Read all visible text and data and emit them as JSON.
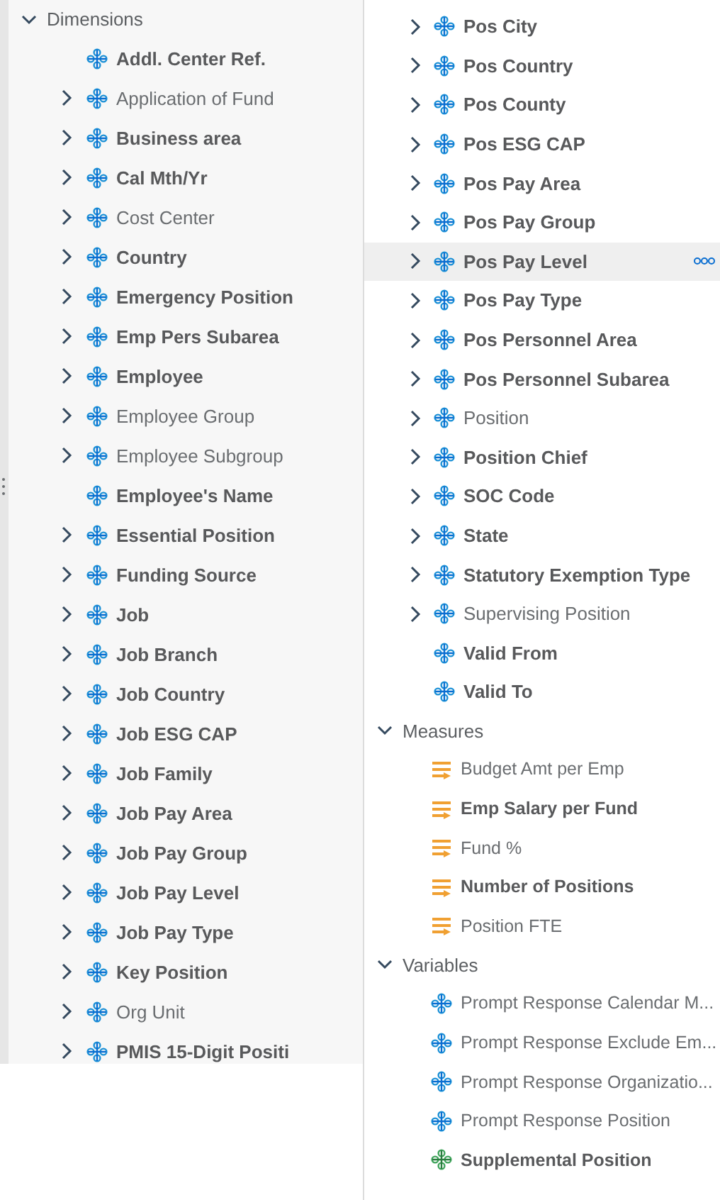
{
  "left_panel": {
    "sections": [
      {
        "title": "Dimensions",
        "expanded": true,
        "items": [
          {
            "label": "Addl. Center Ref.",
            "kind": "dimension",
            "expandable": false,
            "bold": true
          },
          {
            "label": "Application of Fund",
            "kind": "dimension",
            "expandable": true,
            "bold": false
          },
          {
            "label": "Business area",
            "kind": "dimension",
            "expandable": true,
            "bold": true
          },
          {
            "label": "Cal Mth/Yr",
            "kind": "dimension",
            "expandable": true,
            "bold": true
          },
          {
            "label": "Cost Center",
            "kind": "dimension",
            "expandable": true,
            "bold": false
          },
          {
            "label": "Country",
            "kind": "dimension",
            "expandable": true,
            "bold": true
          },
          {
            "label": "Emergency Position",
            "kind": "dimension",
            "expandable": true,
            "bold": true
          },
          {
            "label": "Emp Pers Subarea",
            "kind": "dimension",
            "expandable": true,
            "bold": true
          },
          {
            "label": "Employee",
            "kind": "dimension",
            "expandable": true,
            "bold": true
          },
          {
            "label": "Employee Group",
            "kind": "dimension",
            "expandable": true,
            "bold": false
          },
          {
            "label": "Employee Subgroup",
            "kind": "dimension",
            "expandable": true,
            "bold": false
          },
          {
            "label": "Employee's Name",
            "kind": "dimension",
            "expandable": false,
            "bold": true
          },
          {
            "label": "Essential Position",
            "kind": "dimension",
            "expandable": true,
            "bold": true
          },
          {
            "label": "Funding Source",
            "kind": "dimension",
            "expandable": true,
            "bold": true
          },
          {
            "label": "Job",
            "kind": "dimension",
            "expandable": true,
            "bold": true
          },
          {
            "label": "Job Branch",
            "kind": "dimension",
            "expandable": true,
            "bold": true
          },
          {
            "label": "Job Country",
            "kind": "dimension",
            "expandable": true,
            "bold": true
          },
          {
            "label": "Job ESG CAP",
            "kind": "dimension",
            "expandable": true,
            "bold": true
          },
          {
            "label": "Job Family",
            "kind": "dimension",
            "expandable": true,
            "bold": true
          },
          {
            "label": "Job Pay Area",
            "kind": "dimension",
            "expandable": true,
            "bold": true
          },
          {
            "label": "Job Pay Group",
            "kind": "dimension",
            "expandable": true,
            "bold": true
          },
          {
            "label": "Job Pay Level",
            "kind": "dimension",
            "expandable": true,
            "bold": true
          },
          {
            "label": "Job Pay Type",
            "kind": "dimension",
            "expandable": true,
            "bold": true
          },
          {
            "label": "Key Position",
            "kind": "dimension",
            "expandable": true,
            "bold": true
          },
          {
            "label": "Org Unit",
            "kind": "dimension",
            "expandable": true,
            "bold": false
          },
          {
            "label": "PMIS 15-Digit Positi",
            "kind": "dimension",
            "expandable": true,
            "bold": true
          }
        ]
      }
    ]
  },
  "right_panel": {
    "items": [
      {
        "label": "Pos City",
        "kind": "dimension",
        "expandable": true,
        "bold": true,
        "hovered": false
      },
      {
        "label": "Pos Country",
        "kind": "dimension",
        "expandable": true,
        "bold": true,
        "hovered": false
      },
      {
        "label": "Pos County",
        "kind": "dimension",
        "expandable": true,
        "bold": true,
        "hovered": false
      },
      {
        "label": "Pos ESG CAP",
        "kind": "dimension",
        "expandable": true,
        "bold": true,
        "hovered": false
      },
      {
        "label": "Pos Pay Area",
        "kind": "dimension",
        "expandable": true,
        "bold": true,
        "hovered": false
      },
      {
        "label": "Pos Pay Group",
        "kind": "dimension",
        "expandable": true,
        "bold": true,
        "hovered": false
      },
      {
        "label": "Pos Pay Level",
        "kind": "dimension",
        "expandable": true,
        "bold": true,
        "hovered": true
      },
      {
        "label": "Pos Pay Type",
        "kind": "dimension",
        "expandable": true,
        "bold": true,
        "hovered": false
      },
      {
        "label": "Pos Personnel Area",
        "kind": "dimension",
        "expandable": true,
        "bold": true,
        "hovered": false
      },
      {
        "label": "Pos Personnel Subarea",
        "kind": "dimension",
        "expandable": true,
        "bold": true,
        "hovered": false
      },
      {
        "label": "Position",
        "kind": "dimension",
        "expandable": true,
        "bold": false,
        "hovered": false
      },
      {
        "label": "Position Chief",
        "kind": "dimension",
        "expandable": true,
        "bold": true,
        "hovered": false
      },
      {
        "label": "SOC Code",
        "kind": "dimension",
        "expandable": true,
        "bold": true,
        "hovered": false
      },
      {
        "label": "State",
        "kind": "dimension",
        "expandable": true,
        "bold": true,
        "hovered": false
      },
      {
        "label": "Statutory Exemption Type",
        "kind": "dimension",
        "expandable": true,
        "bold": true,
        "hovered": false
      },
      {
        "label": "Supervising Position",
        "kind": "dimension",
        "expandable": true,
        "bold": false,
        "hovered": false
      },
      {
        "label": "Valid From",
        "kind": "dimension",
        "expandable": false,
        "bold": true,
        "hovered": false
      },
      {
        "label": "Valid To",
        "kind": "dimension",
        "expandable": false,
        "bold": true,
        "hovered": false
      }
    ],
    "sections": [
      {
        "title": "Measures",
        "expanded": true,
        "items": [
          {
            "label": "Budget Amt per Emp",
            "kind": "measure",
            "expandable": false,
            "bold": false
          },
          {
            "label": "Emp Salary per Fund",
            "kind": "measure",
            "expandable": false,
            "bold": true
          },
          {
            "label": "Fund %",
            "kind": "measure",
            "expandable": false,
            "bold": false
          },
          {
            "label": "Number of Positions",
            "kind": "measure",
            "expandable": false,
            "bold": true
          },
          {
            "label": "Position FTE",
            "kind": "measure",
            "expandable": false,
            "bold": false
          }
        ]
      },
      {
        "title": "Variables",
        "expanded": true,
        "items": [
          {
            "label": "Prompt Response Calendar M...",
            "kind": "dimension",
            "expandable": false,
            "bold": false
          },
          {
            "label": "Prompt Response Exclude Em...",
            "kind": "dimension",
            "expandable": false,
            "bold": false
          },
          {
            "label": "Prompt Response Organizatio...",
            "kind": "dimension",
            "expandable": false,
            "bold": false
          },
          {
            "label": "Prompt Response Position",
            "kind": "dimension",
            "expandable": false,
            "bold": false
          },
          {
            "label": "Supplemental Position",
            "kind": "custom",
            "expandable": false,
            "bold": true
          }
        ]
      }
    ]
  }
}
